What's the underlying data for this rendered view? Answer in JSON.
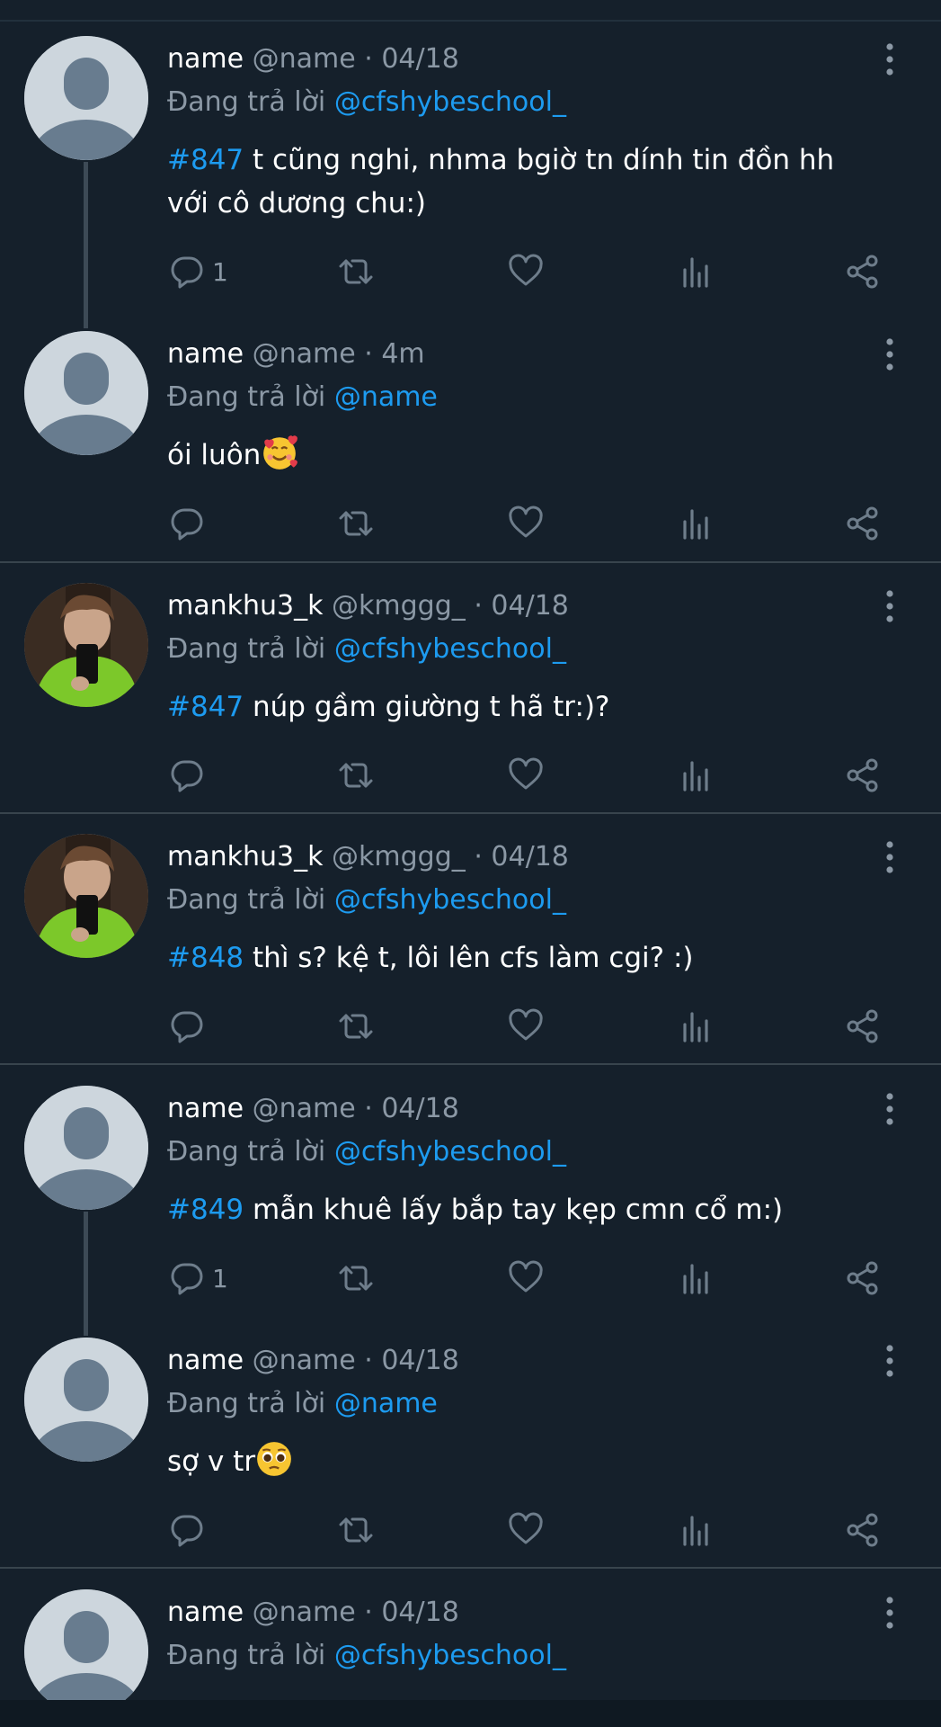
{
  "tweets": [
    {
      "name": "name",
      "handle": "@name",
      "sep": "·",
      "date": "04/18",
      "reply_prefix": "Đang trả lời",
      "reply_to": "@cfshybeschool_",
      "tag": "#847",
      "text": " t cũng nghi, nhma bgiờ tn dính tin đồn hh với cô dương chu:)",
      "reply_count": "1"
    },
    {
      "name": "name",
      "handle": "@name",
      "sep": "·",
      "date": "4m",
      "reply_prefix": "Đang trả lời",
      "reply_to": "@name",
      "tag": "",
      "text": "ói luôn",
      "reply_count": ""
    },
    {
      "name": "mankhu3_k",
      "handle": "@kmggg_",
      "sep": "·",
      "date": "04/18",
      "reply_prefix": "Đang trả lời",
      "reply_to": "@cfshybeschool_",
      "tag": "#847",
      "text": " núp gầm giường t hã tr:)?",
      "reply_count": ""
    },
    {
      "name": "mankhu3_k",
      "handle": "@kmggg_",
      "sep": "·",
      "date": "04/18",
      "reply_prefix": "Đang trả lời",
      "reply_to": "@cfshybeschool_",
      "tag": "#848",
      "text": " thì s? kệ t, lôi lên cfs làm cgi? :)",
      "reply_count": ""
    },
    {
      "name": "name",
      "handle": "@name",
      "sep": "·",
      "date": "04/18",
      "reply_prefix": "Đang trả lời",
      "reply_to": "@cfshybeschool_",
      "tag": "#849",
      "text": " mẫn khuê lấy bắp tay kẹp cmn cổ m:)",
      "reply_count": "1"
    },
    {
      "name": "name",
      "handle": "@name",
      "sep": "·",
      "date": "04/18",
      "reply_prefix": "Đang trả lời",
      "reply_to": "@name",
      "tag": "",
      "text": "sợ v tr",
      "reply_count": ""
    },
    {
      "name": "name",
      "handle": "@name",
      "sep": "·",
      "date": "04/18",
      "reply_prefix": "Đang trả lời",
      "reply_to": "@cfshybeschool_",
      "tag": "",
      "text": "",
      "reply_count": ""
    }
  ],
  "icons": {
    "reply": "reply-icon",
    "retweet": "retweet-icon",
    "like": "heart-icon",
    "views": "analytics-icon",
    "share": "share-icon",
    "more": "more-vertical-icon"
  },
  "colors": {
    "background": "#15202b",
    "link": "#1d9bf0",
    "muted": "#8b98a5",
    "divider": "#38444d"
  }
}
